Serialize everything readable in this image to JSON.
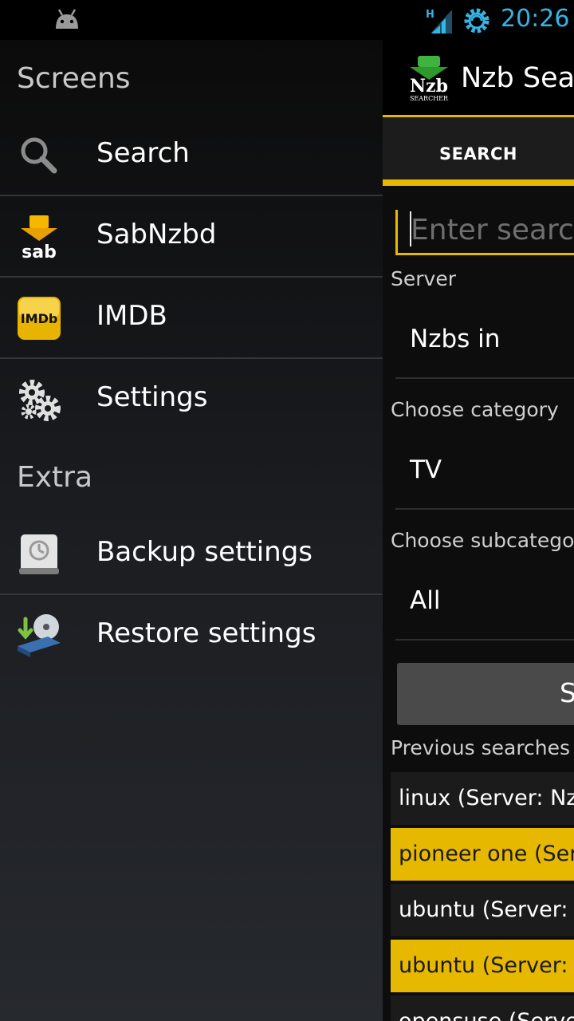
{
  "status": {
    "time": "20:26",
    "network_type": "H"
  },
  "app": {
    "title": "Nzb Searcher",
    "logo_text": "Nzb",
    "logo_subtext": "SEARCHER",
    "tab_search": "SEARCH",
    "search_placeholder": "Enter search",
    "server_label": "Server",
    "server_value": "Nzbs in",
    "category_label": "Choose category",
    "category_value": "TV",
    "subcategory_label": "Choose subcatego",
    "subcategory_value": "All",
    "submit_label": "S",
    "previous_label": "Previous searches",
    "previous": [
      "linux (Server: Nzb",
      "pioneer one (Serv",
      "ubuntu (Server: N",
      "ubuntu (Server: N",
      "opensuse (Server"
    ]
  },
  "drawer": {
    "section_screens": "Screens",
    "section_extra": "Extra",
    "items": [
      {
        "label": "Search",
        "icon": "search-icon"
      },
      {
        "label": "SabNzbd",
        "icon": "sabnzbd-icon"
      },
      {
        "label": "IMDB",
        "icon": "imdb-icon"
      },
      {
        "label": "Settings",
        "icon": "gear-icon"
      },
      {
        "label": "Backup settings",
        "icon": "backup-drive-icon"
      },
      {
        "label": "Restore settings",
        "icon": "restore-disc-icon"
      }
    ],
    "sab_text": "sab",
    "imdb_text": "IMDb"
  },
  "colors": {
    "accent": "#e6b800",
    "clock": "#33b5e5"
  }
}
